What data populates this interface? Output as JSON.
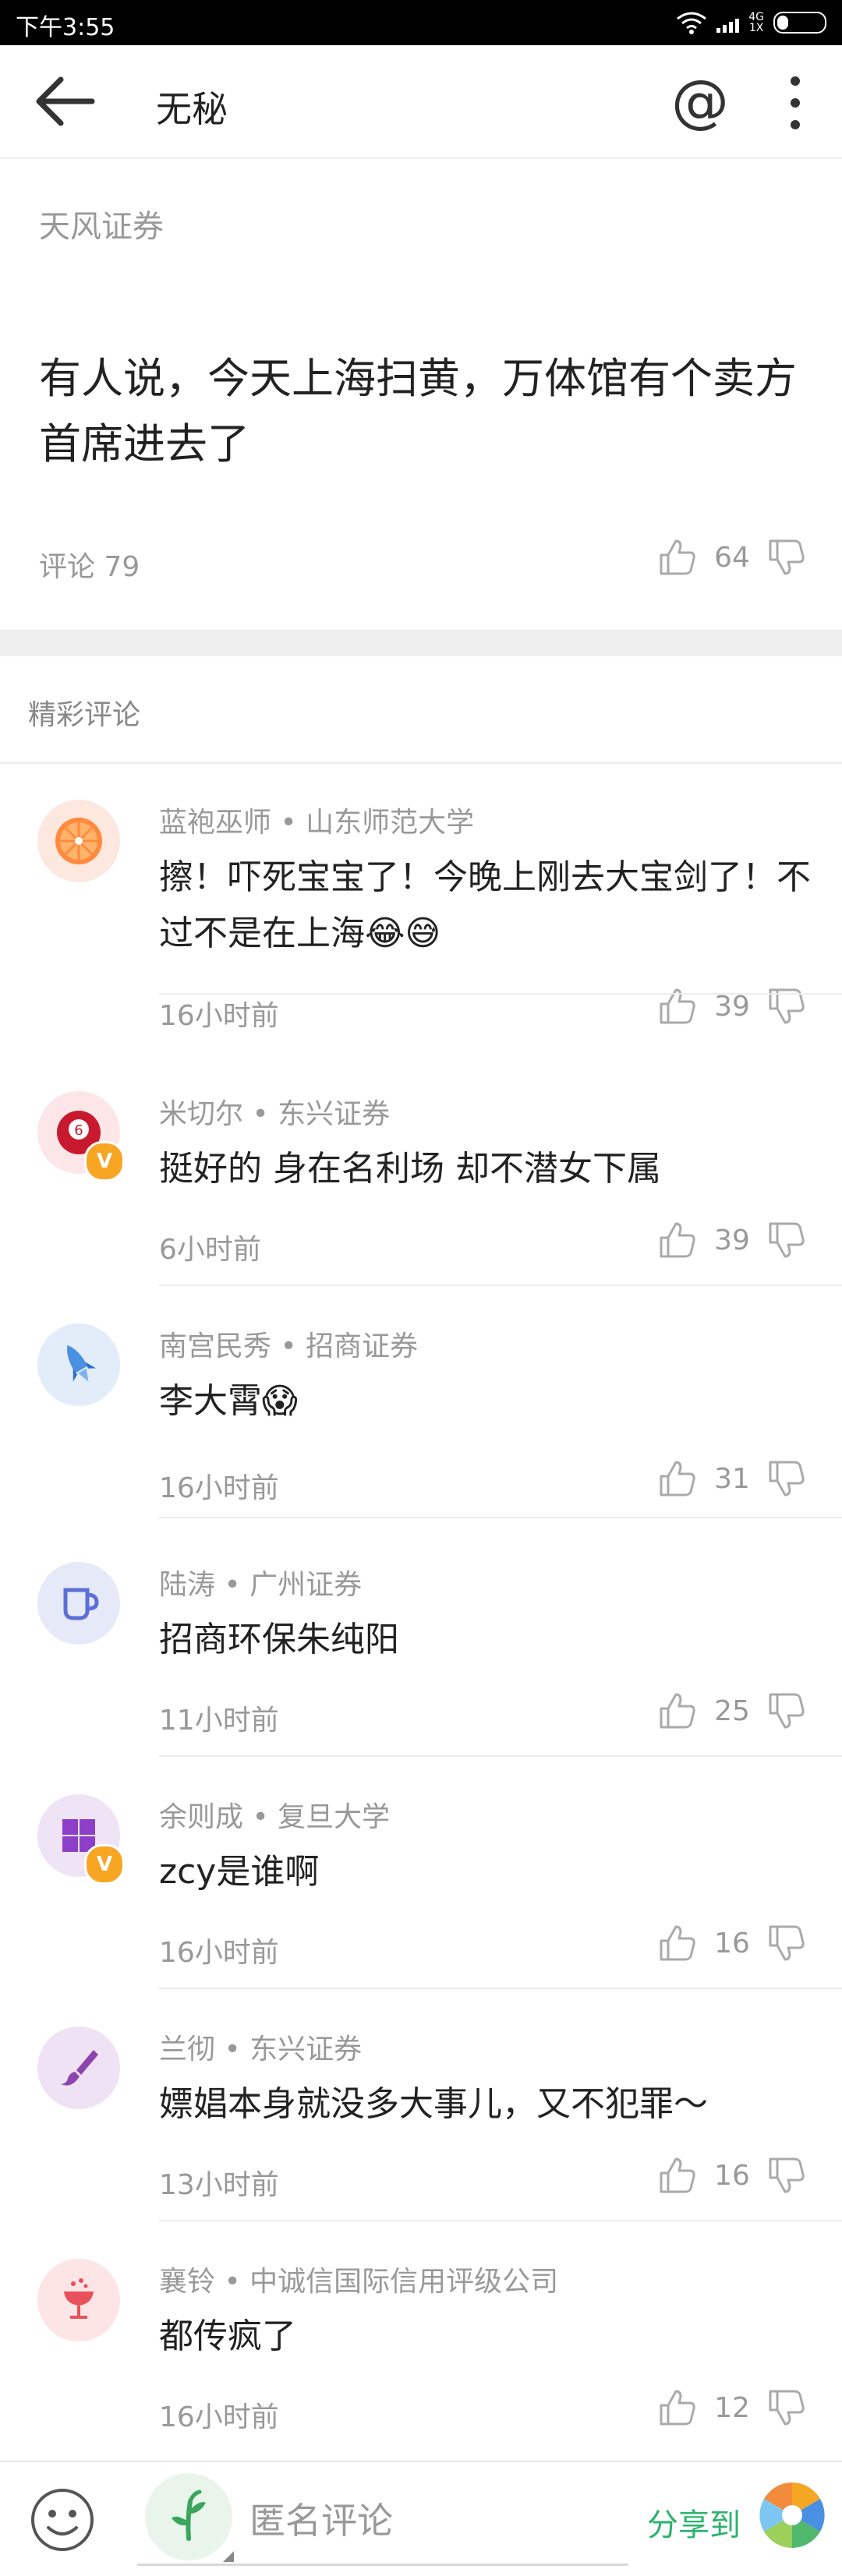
{
  "status_bar": {
    "time": "下午3:55",
    "network_top": "4G",
    "network_bottom": "1X"
  },
  "app_bar": {
    "title": "无秘",
    "at_symbol": "@"
  },
  "post": {
    "author": "天风证券",
    "content": "有人说，今天上海扫黄，万体馆有个卖方首席进去了",
    "comment_count": "评论 79",
    "likes": "64"
  },
  "section": {
    "title": "精彩评论"
  },
  "comments": [
    {
      "meta": "蓝袍巫师 • 山东师范大学",
      "text": "擦！吓死宝宝了！今晚上刚去大宝剑了！不过不是在上海😂😅",
      "time": "16小时前",
      "likes": "39",
      "avatar_icon": "orange-slice-icon",
      "avatar_color": "#ff8a3d",
      "verified": false
    },
    {
      "meta": "米切尔 • 东兴证券",
      "text": "挺好的 身在名利场 却不潜女下属",
      "time": "6小时前",
      "likes": "39",
      "avatar_icon": "billiard-ball-icon",
      "avatar_color": "#c8192f",
      "verified": true,
      "ball_number": "6"
    },
    {
      "meta": "南宫民秀 • 招商证券",
      "text": "李大霄😱",
      "time": "16小时前",
      "likes": "31",
      "avatar_icon": "rocket-icon",
      "avatar_color": "#4a90e2",
      "verified": false
    },
    {
      "meta": "陆涛 • 广州证券",
      "text": "招商环保朱纯阳",
      "time": "11小时前",
      "likes": "25",
      "avatar_icon": "mug-icon",
      "avatar_color": "#5b6fd6",
      "verified": false
    },
    {
      "meta": "余则成 • 复旦大学",
      "text": "zcy是谁啊",
      "time": "16小时前",
      "likes": "16",
      "avatar_icon": "window-grid-icon",
      "avatar_color": "#8e3fc9",
      "verified": true
    },
    {
      "meta": "兰彻 • 东兴证券",
      "text": "嫖娼本身就没多大事儿，又不犯罪～",
      "time": "13小时前",
      "likes": "16",
      "avatar_icon": "brush-icon",
      "avatar_color": "#8e44ad",
      "verified": false
    },
    {
      "meta": "襄铃 • 中诚信国际信用评级公司",
      "text": "都传疯了",
      "time": "16小时前",
      "likes": "12",
      "avatar_icon": "cocktail-icon",
      "avatar_color": "#e8505b",
      "verified": false
    }
  ],
  "verified_badge": "V",
  "bottom_bar": {
    "input_placeholder": "匿名评论",
    "share_label": "分享到"
  },
  "colors": {
    "accent_green": "#2db36e",
    "meta_gray": "#999999",
    "divider": "#ececec"
  }
}
